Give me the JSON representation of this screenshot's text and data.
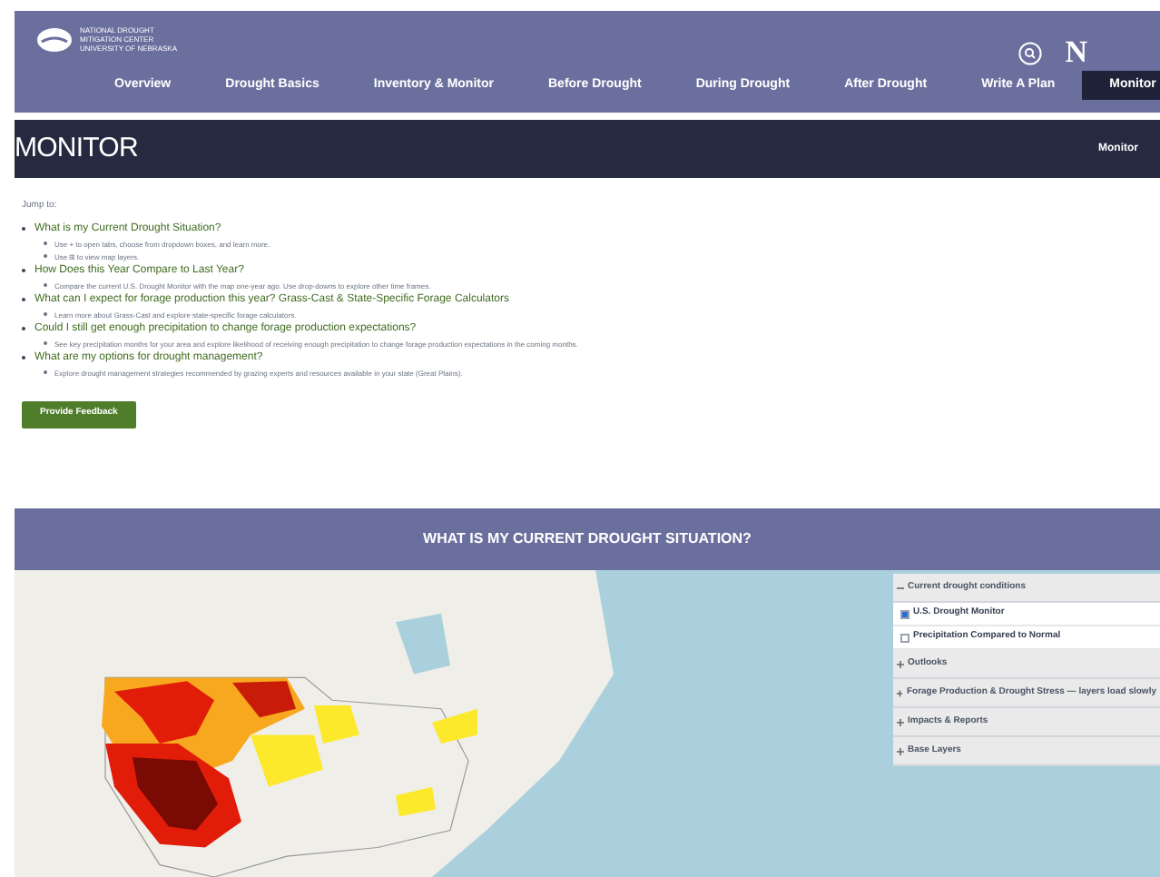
{
  "logo": {
    "lines": [
      "NATIONAL DROUGHT",
      "MITIGATION CENTER",
      "UNIVERSITY OF NEBRASKA"
    ]
  },
  "nav": [
    {
      "label": "Overview",
      "selected": false
    },
    {
      "label": "Drought Basics",
      "selected": false
    },
    {
      "label": "Inventory & Monitor",
      "selected": false
    },
    {
      "label": "Before Drought",
      "selected": false
    },
    {
      "label": "During Drought",
      "selected": false
    },
    {
      "label": "After Drought",
      "selected": false
    },
    {
      "label": "Write A Plan",
      "selected": false
    },
    {
      "label": "Monitor",
      "selected": true
    }
  ],
  "brand_letter": "N",
  "page_title": "MONITOR",
  "breadcrumb": "Monitor",
  "jump_label": "Jump to:",
  "jump_links": [
    {
      "label": "What is my Current Drought Situation?",
      "notes": [
        "Use + to open tabs, choose from dropdown boxes, and learn more.",
        "Use ⊞ to view map layers."
      ]
    },
    {
      "label": "How Does this Year Compare to Last Year?",
      "notes": [
        "Compare the current U.S. Drought Monitor with the map one-year ago. Use drop-downs to explore other time frames."
      ]
    },
    {
      "label": "What can I expect for forage production this year? Grass-Cast & State-Specific Forage Calculators",
      "notes": [
        "Learn more about Grass-Cast and explore state-specific forage calculators."
      ]
    },
    {
      "label": "Could I still get enough precipitation to change forage production expectations?",
      "notes": [
        "See key precipitation months for your area and explore likelihood of receiving enough precipitation to change forage production expectations in the coming months."
      ]
    },
    {
      "label": "What are my options for drought management?",
      "notes": [
        "Explore drought management strategies recommended by grazing experts and resources available in your state (Great Plains)."
      ]
    }
  ],
  "feedback_button": "Provide Feedback",
  "section_title": "WHAT IS MY CURRENT DROUGHT SITUATION?",
  "layers": [
    {
      "label": "Current drought conditions",
      "expanded": true,
      "children": [
        {
          "label": "U.S. Drought Monitor",
          "checked": true
        },
        {
          "label": "Precipitation Compared to Normal",
          "checked": false
        }
      ]
    },
    {
      "label": "Outlooks",
      "expanded": false
    },
    {
      "label": "Forage Production & Drought Stress — layers load slowly",
      "expanded": false
    },
    {
      "label": "Impacts & Reports",
      "expanded": false
    },
    {
      "label": "Base Layers",
      "expanded": false
    }
  ]
}
